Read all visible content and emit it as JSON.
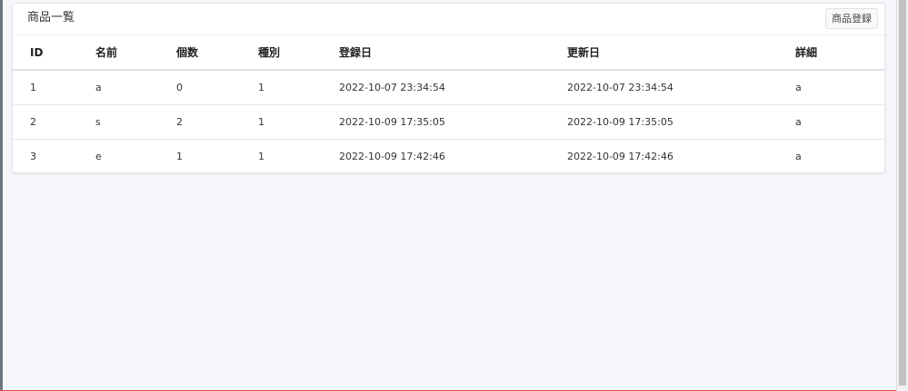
{
  "card": {
    "title": "商品一覧",
    "register_button": "商品登録"
  },
  "table": {
    "headers": {
      "id": "ID",
      "name": "名前",
      "quantity": "個数",
      "type": "種別",
      "created": "登録日",
      "updated": "更新日",
      "detail": "詳細"
    },
    "rows": [
      {
        "id": "1",
        "name": "a",
        "quantity": "0",
        "type": "1",
        "created": "2022-10-07 23:34:54",
        "updated": "2022-10-07 23:34:54",
        "detail": "a"
      },
      {
        "id": "2",
        "name": "s",
        "quantity": "2",
        "type": "1",
        "created": "2022-10-09 17:35:05",
        "updated": "2022-10-09 17:35:05",
        "detail": "a"
      },
      {
        "id": "3",
        "name": "e",
        "quantity": "1",
        "type": "1",
        "created": "2022-10-09 17:42:46",
        "updated": "2022-10-09 17:42:46",
        "detail": "a"
      }
    ]
  },
  "colors": {
    "page_background": "#f4f6f9",
    "card_background": "#ffffff",
    "border": "#dee2e6",
    "bottom_accent": "#d9534f"
  }
}
